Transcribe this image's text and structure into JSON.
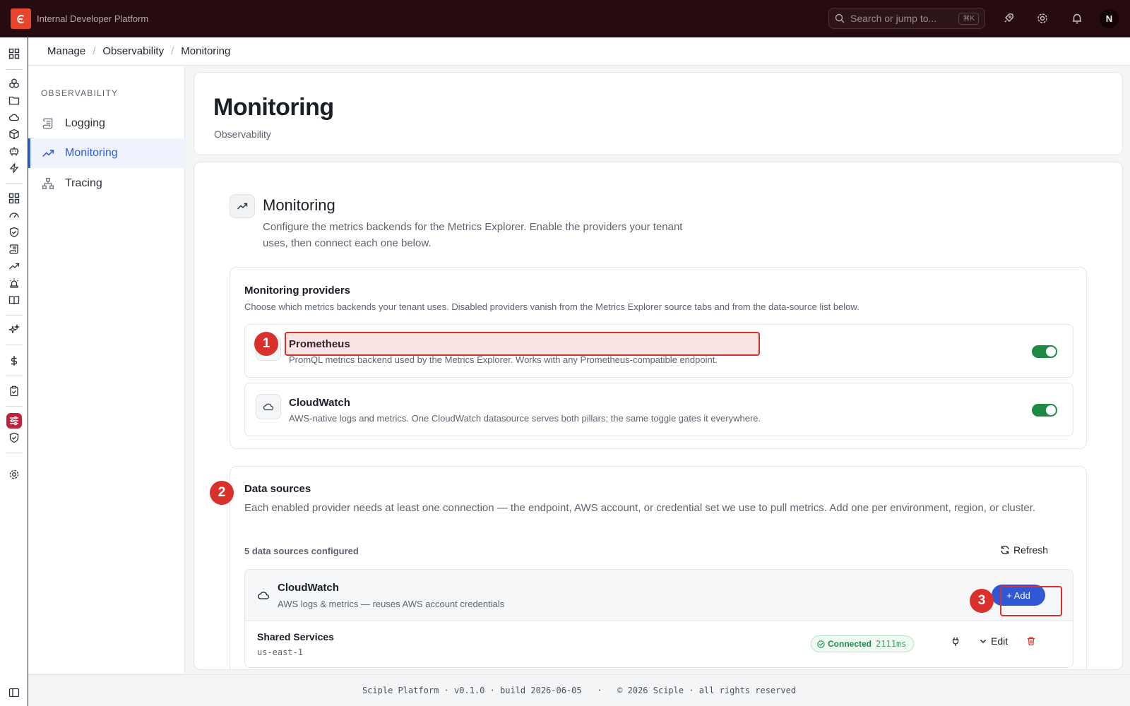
{
  "app": {
    "title": "Internal Developer Platform",
    "logo_letter": "C"
  },
  "topbar": {
    "search_placeholder": "Search or jump to...",
    "search_shortcut": "⌘K",
    "avatar_initial": "N"
  },
  "breadcrumb": [
    "Manage",
    "Observability",
    "Monitoring"
  ],
  "sidenav": {
    "heading": "OBSERVABILITY",
    "items": [
      {
        "label": "Logging",
        "icon": "scroll-icon",
        "active": false
      },
      {
        "label": "Monitoring",
        "icon": "trending-up-icon",
        "active": true
      },
      {
        "label": "Tracing",
        "icon": "network-icon",
        "active": false
      }
    ]
  },
  "page": {
    "title": "Monitoring",
    "subtitle": "Observability"
  },
  "section": {
    "title": "Monitoring",
    "description": "Configure the metrics backends for the Metrics Explorer. Enable the providers your tenant uses, then connect each one below."
  },
  "providers_panel": {
    "title": "Monitoring providers",
    "description": "Choose which metrics backends your tenant uses. Disabled providers vanish from the Metrics Explorer source tabs and from the data-source list below.",
    "providers": [
      {
        "name": "Prometheus",
        "description": "PromQL metrics backend used by the Metrics Explorer. Works with any Prometheus-compatible endpoint.",
        "enabled": true
      },
      {
        "name": "CloudWatch",
        "description": "AWS-native logs and metrics. One CloudWatch datasource serves both pillars; the same toggle gates it everywhere.",
        "enabled": true
      }
    ]
  },
  "datasources_panel": {
    "title": "Data sources",
    "description": "Each enabled provider needs at least one connection — the endpoint, AWS account, or credential set we use to pull metrics. Add one per environment, region, or cluster.",
    "count_text": "5 data sources configured",
    "refresh_label": "Refresh",
    "group": {
      "name": "CloudWatch",
      "description": "AWS logs & metrics — reuses AWS account credentials",
      "add_label": "+ Add"
    },
    "rows": [
      {
        "name": "Shared Services",
        "region": "us-east-1",
        "status": "Connected",
        "latency": "2111ms",
        "edit_label": "Edit"
      }
    ]
  },
  "annotations": [
    "1",
    "2",
    "3"
  ],
  "footer": {
    "text": "Sciple Platform · v0.1.0 · build 2026-06-05   ·   © 2026 Sciple · all rights reserved"
  },
  "colors": {
    "topbar": "#260c10",
    "accent": "#3158d4",
    "active_nav": "#2c5fd6",
    "toggle_on": "#1e8a45",
    "annotation": "#d9302b",
    "logo": "#e8452c"
  }
}
